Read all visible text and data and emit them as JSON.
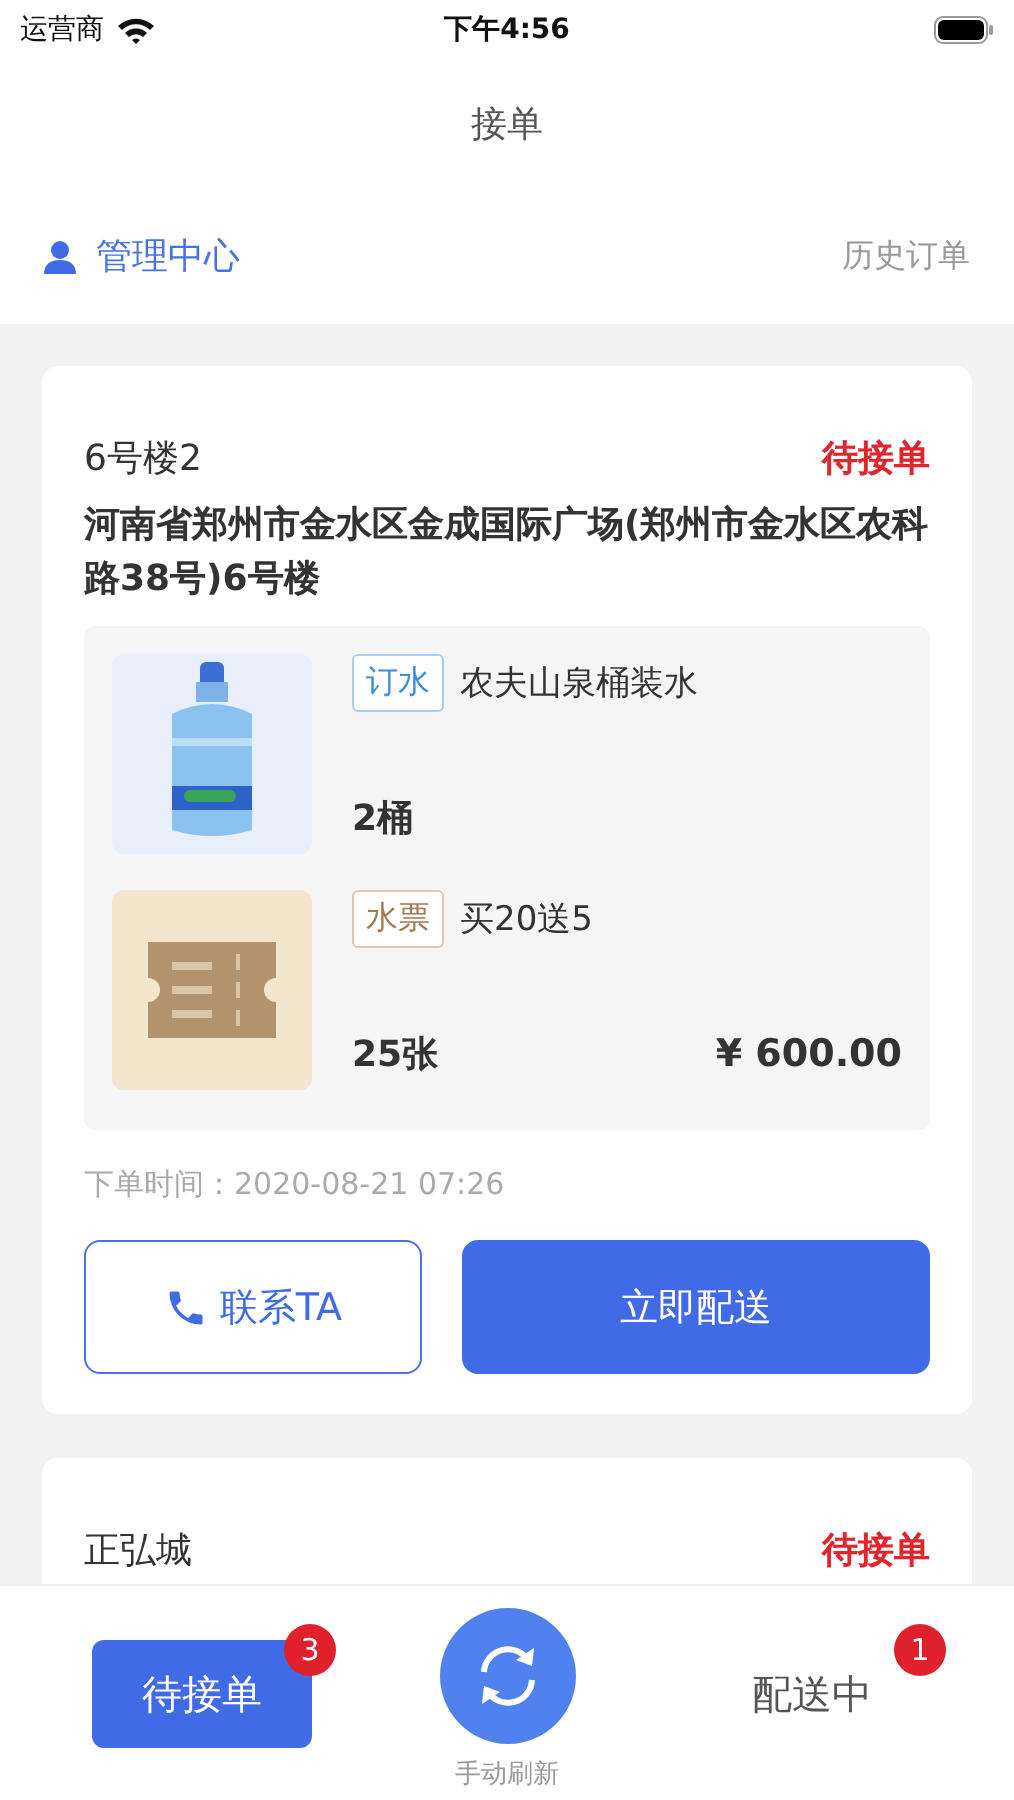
{
  "status_bar": {
    "carrier": "运营商",
    "time": "下午4:56"
  },
  "nav": {
    "title": "接单"
  },
  "subheader": {
    "left": "管理中心",
    "right": "历史订单"
  },
  "orders": [
    {
      "name": "6号楼2",
      "status": "待接单",
      "address": "河南省郑州市金水区金成国际广场(郑州市金水区农科路38号)6号楼",
      "items": [
        {
          "kind": "water",
          "tag": "订水",
          "title": "农夫山泉桶装水",
          "quantity": "2桶"
        },
        {
          "kind": "ticket",
          "tag": "水票",
          "title": "买20送5",
          "quantity": "25张",
          "price": "¥ 600.00"
        }
      ],
      "time": "下单时间：2020-08-21 07:26",
      "contact_button": "联系TA",
      "deliver_button": "立即配送"
    },
    {
      "name": "正弘城",
      "status": "待接单"
    }
  ],
  "bottom_tabs": [
    {
      "label": "待接单",
      "badge": "3",
      "selected": true
    },
    {
      "label": "配送中",
      "badge": "1",
      "selected": false
    }
  ],
  "refresh": {
    "label": "手动刷新"
  }
}
